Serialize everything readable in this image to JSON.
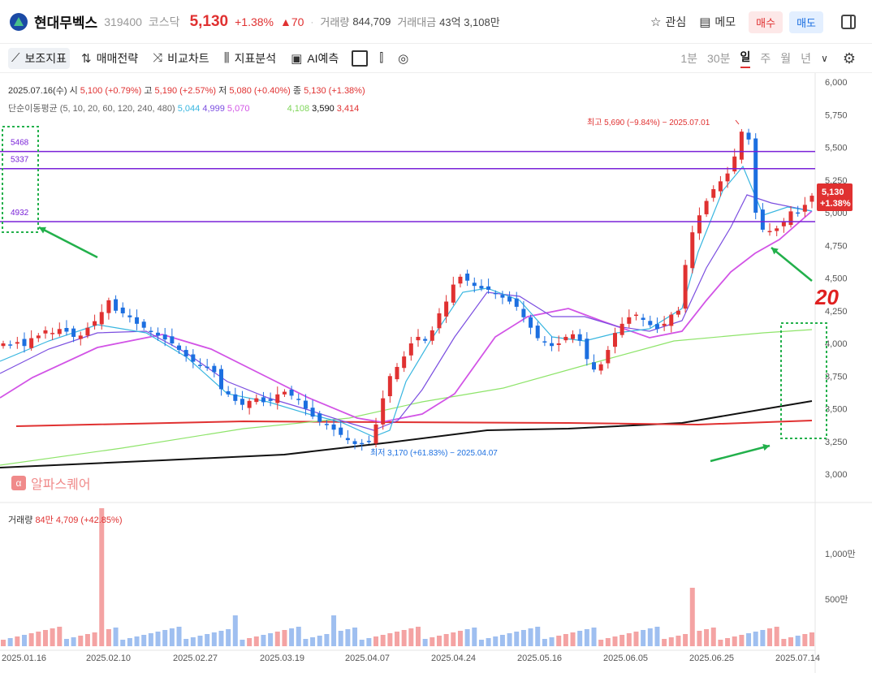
{
  "header": {
    "stock_name": "현대무벡스",
    "stock_code": "319400",
    "market": "코스닥",
    "price": "5,130",
    "change_pct": "+1.38%",
    "change_abs": "▲70",
    "volume_label": "거래량",
    "volume_value": "844,709",
    "amount_label": "거래대금",
    "amount_value": "43억 3,108만",
    "watch_label": "관심",
    "memo_label": "메모",
    "buy_label": "매수",
    "sell_label": "매도"
  },
  "toolbar": {
    "indicator_label": "보조지표",
    "strategy_label": "매매전략",
    "compare_label": "비교차트",
    "analysis_label": "지표분석",
    "ai_label": "AI예측",
    "periods": [
      "1분",
      "30분",
      "일",
      "주",
      "월",
      "년"
    ],
    "selected_period": "일"
  },
  "info": {
    "date": "2025.07.16(수)",
    "open_label": "시",
    "open": "5,100 (+0.79%)",
    "high_label": "고",
    "high": "5,190 (+2.57%)",
    "low_label": "저",
    "low": "5,080 (+0.40%)",
    "close_label": "종",
    "close": "5,130 (+1.38%)",
    "ma_label": "단순이동평균 (5, 10, 20, 60, 120, 240, 480)",
    "ma5": "5,044",
    "ma10": "4,999",
    "ma20": "5,070",
    "ma120": "4,108",
    "ma240": "3,590",
    "ma480": "3,414"
  },
  "annotations": {
    "high_marker": "최고 5,690 (−9.84%) − 2025.07.01",
    "low_marker": "최저 3,170 (+61.83%) − 2025.04.07",
    "level_labels": [
      "5468",
      "5337",
      "4932"
    ],
    "price_tag": "5,130",
    "price_tag_pct": "+1.38%",
    "handwriting": "20"
  },
  "watermark": "알파스퀘어",
  "volume_info": {
    "label": "거래량",
    "value": "84만 4,709 (+42.85%)"
  },
  "colors": {
    "up": "#e03131",
    "down": "#1c6fe0",
    "level": "#7a22d8",
    "arrow": "#22b04b"
  },
  "chart_data": {
    "type": "candlestick",
    "price_axis": [
      "6,000",
      "5,750",
      "5,500",
      "5,250",
      "5,000",
      "4,750",
      "4,500",
      "4,250",
      "4,000",
      "3,750",
      "3,500",
      "3,250",
      "3,000"
    ],
    "volume_axis": [
      "1,000만",
      "500만"
    ],
    "date_labels": [
      "2025.01.16",
      "2025.02.10",
      "2025.02.27",
      "2025.03.19",
      "2025.04.07",
      "2025.04.24",
      "2025.05.16",
      "2025.06.05",
      "2025.06.25",
      "2025.07.14"
    ],
    "levels": [
      5468,
      5337,
      4932
    ],
    "series_closes": [
      4000,
      3990,
      4010,
      3980,
      4040,
      4060,
      4100,
      4080,
      4110,
      4090,
      4050,
      4060,
      4120,
      4170,
      4240,
      4330,
      4250,
      4230,
      4200,
      4150,
      4120,
      4090,
      4060,
      4030,
      4000,
      3950,
      3900,
      3860,
      3830,
      3820,
      3780,
      3650,
      3610,
      3560,
      3530,
      3560,
      3580,
      3550,
      3560,
      3610,
      3630,
      3600,
      3570,
      3500,
      3440,
      3400,
      3380,
      3340,
      3300,
      3260,
      3230,
      3230,
      3250,
      3380,
      3580,
      3750,
      3820,
      3900,
      4000,
      4050,
      4020,
      4100,
      4230,
      4320,
      4450,
      4510,
      4480,
      4440,
      4420,
      4410,
      4380,
      4350,
      4320,
      4280,
      4200,
      4120,
      4040,
      4010,
      3980,
      4000,
      4050,
      4070,
      4020,
      3880,
      3800,
      3840,
      3950,
      4080,
      4150,
      4200,
      4220,
      4180,
      4140,
      4110,
      4150,
      4220,
      4250,
      4600,
      4850,
      4980,
      5090,
      5180,
      5240,
      5300,
      5430,
      5620,
      5560,
      5000,
      4870,
      4860,
      4880,
      4930,
      5010,
      5000,
      5060,
      5130
    ],
    "volume_ma_note": ""
  }
}
